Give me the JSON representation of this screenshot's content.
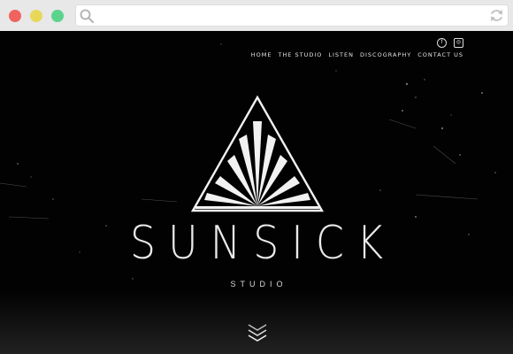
{
  "browser": {
    "url": "",
    "icons": [
      "search-icon",
      "refresh-icon"
    ]
  },
  "site": {
    "social": [
      "facebook-icon",
      "instagram-icon"
    ],
    "nav": [
      {
        "label": "HOME"
      },
      {
        "label": "THE STUDIO"
      },
      {
        "label": "LISTEN"
      },
      {
        "label": "DISCOGRAPHY"
      },
      {
        "label": "CONTACT US"
      }
    ],
    "brand": "SUNSICK",
    "tagline": "STUDIO",
    "colors": {
      "background": "#000000",
      "text": "#eaeaea",
      "logo": "#f2f2f2"
    }
  }
}
